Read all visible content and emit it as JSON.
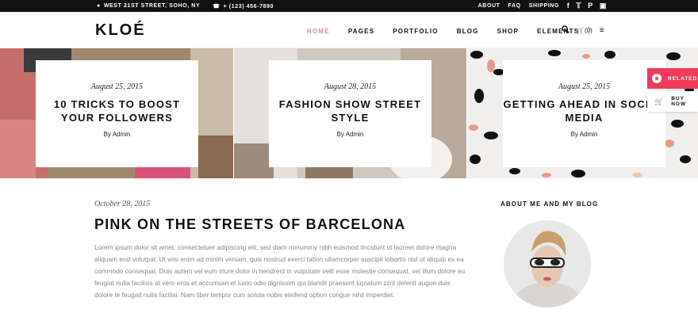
{
  "topbar": {
    "address": "WEST 21ST STREET, SOHO, NY",
    "phone": "+ (123) 456-7890",
    "links": [
      "ABOUT",
      "FAQ",
      "SHIPPING"
    ],
    "social_icons": [
      "facebook-icon",
      "twitter-icon",
      "pinterest-icon",
      "instagram-icon"
    ]
  },
  "header": {
    "logo": "KLOÉ",
    "nav": [
      "HOME",
      "PAGES",
      "PORTFOLIO",
      "BLOG",
      "SHOP",
      "ELEMENTS"
    ],
    "active_nav": "HOME",
    "cart_count": "(0)"
  },
  "slider": [
    {
      "date": "August 25, 2015",
      "title": "10 TRICKS TO BOOST YOUR FOLLOWERS",
      "author": "By Admin"
    },
    {
      "date": "August 28, 2015",
      "title": "FASHION SHOW STREET STYLE",
      "author": "By Admin"
    },
    {
      "date": "August 25, 2015",
      "title": "GETTING AHEAD IN SOCIAL MEDIA",
      "author": "By Admin"
    }
  ],
  "side_buttons": {
    "related": "RELATED",
    "buy_now": "BUY NOW"
  },
  "post": {
    "date": "October 28, 2015",
    "title": "PINK ON THE STREETS OF BARCELONA",
    "body": "Lorem ipsum dolor sit amet, consectetuer adipiscing elit, sed diam nonummy nibh euismod tincidunt ut laoreet dolore magna aliquam erat volutpat. Ut wisi enim ad minim veniam, quis nostrud exerci tation ullamcorper suscipit lobortis nisl ut aliquip ex ea commodo consequat. Duis autem vel eum iriure dolor in hendrerit in vulputate velit esse molestie consequat, vel illum dolore eu feugiat nulla facilisis at vero eros et accumsan et iusto odio dignissim qui blandit praesent luptatum zzril delenit augue duis dolore te feugait nulla facilisi. Nam liber tempor cum soluta nobis eleifend option congue nihil imperdiet."
  },
  "sidebar": {
    "title": "ABOUT ME AND MY BLOG"
  },
  "colors": {
    "accent": "#e0868a",
    "related": "#f03c5a",
    "topbar": "#111111"
  }
}
